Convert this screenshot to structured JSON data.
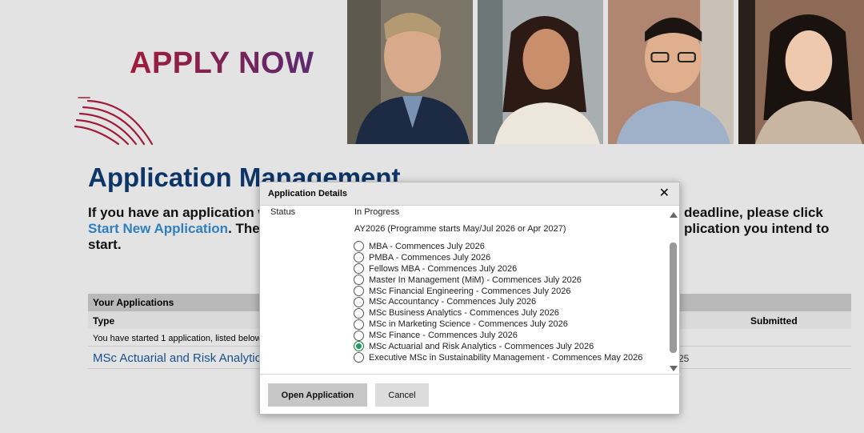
{
  "banner": {
    "apply_now": "APPLY NOW"
  },
  "page": {
    "title": "Application Management",
    "intro_line1_start": "If you have an application w",
    "intro_line1_end": "deadline, please click",
    "intro_link": "Start New Application",
    "intro_line2_mid": ". The",
    "intro_line2_end": "plication you intend to",
    "intro_line3": "start."
  },
  "applications": {
    "section_title": "Your Applications",
    "col_type": "Type",
    "col_submitted": "Submitted",
    "note": "You have started 1 application, listed below",
    "rows": [
      {
        "type": "MSc Actuarial and Risk Analytics",
        "date_fragment": "25"
      }
    ]
  },
  "modal": {
    "title": "Application Details",
    "close_glyph": "✕",
    "status_label": "Status",
    "status_value": "In Progress",
    "ay_note": "AY2026 (Programme starts May/Jul 2026 or Apr 2027)",
    "options": [
      {
        "label": "MBA - Commences July 2026",
        "checked": false
      },
      {
        "label": "PMBA - Commences July 2026",
        "checked": false
      },
      {
        "label": "Fellows MBA - Commences July 2026",
        "checked": false
      },
      {
        "label": "Master In Management (MiM) - Commences July 2026",
        "checked": false
      },
      {
        "label": "MSc Financial Engineering - Commences July 2026",
        "checked": false
      },
      {
        "label": "MSc Accountancy - Commences July 2026",
        "checked": false
      },
      {
        "label": "MSc Business Analytics - Commences July 2026",
        "checked": false
      },
      {
        "label": "MSc in Marketing Science - Commences July 2026",
        "checked": false
      },
      {
        "label": "MSc Finance - Commences July 2026",
        "checked": false
      },
      {
        "label": "MSc Actuarial and Risk Analytics - Commences July 2026",
        "checked": true
      },
      {
        "label": "Executive MSc in Sustainability Management - Commences May 2026",
        "checked": false
      }
    ],
    "open_button": "Open Application",
    "cancel_button": "Cancel"
  },
  "colors": {
    "title_blue": "#0d3568",
    "link_blue": "#2f7fc0",
    "selected_green": "#1aa053",
    "brand_red": "#a01c3a"
  }
}
